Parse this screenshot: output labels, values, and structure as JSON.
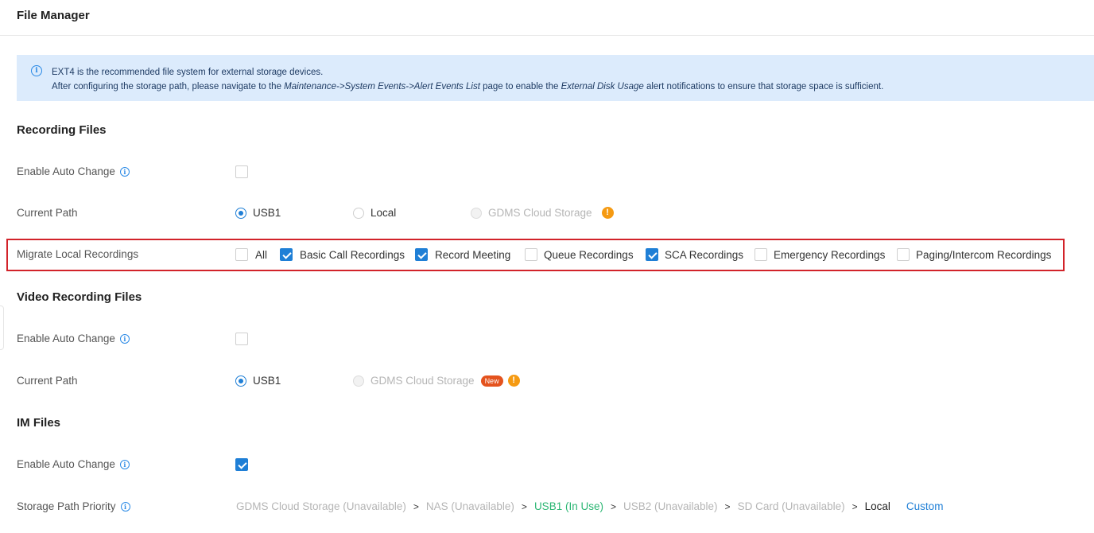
{
  "header": {
    "title": "File Manager"
  },
  "notice": {
    "line1": "EXT4 is the recommended file system for external storage devices.",
    "line2_a": "After configuring the storage path, please navigate to the ",
    "line2_link": "Maintenance->System Events->Alert Events List",
    "line2_b": " page to enable the ",
    "line2_em": "External Disk Usage",
    "line2_c": " alert notifications to ensure that storage space is sufficient."
  },
  "recording": {
    "title": "Recording Files",
    "auto_change_label": "Enable Auto Change",
    "auto_change_checked": false,
    "path_label": "Current Path",
    "path_options": [
      "USB1",
      "Local",
      "GDMS Cloud Storage"
    ],
    "path_selected": "USB1",
    "migrate_label": "Migrate Local Recordings",
    "migrate_options": [
      {
        "label": "All",
        "checked": false
      },
      {
        "label": "Basic Call Recordings",
        "checked": true
      },
      {
        "label": "Record Meeting",
        "checked": true
      },
      {
        "label": "Queue Recordings",
        "checked": false
      },
      {
        "label": "SCA Recordings",
        "checked": true
      },
      {
        "label": "Emergency Recordings",
        "checked": false
      },
      {
        "label": "Paging/Intercom Recordings",
        "checked": false
      }
    ]
  },
  "video": {
    "title": "Video Recording Files",
    "auto_change_label": "Enable Auto Change",
    "auto_change_checked": false,
    "path_label": "Current Path",
    "path_options": [
      "USB1",
      "GDMS Cloud Storage"
    ],
    "path_selected": "USB1",
    "new_badge": "New"
  },
  "im": {
    "title": "IM Files",
    "auto_change_label": "Enable Auto Change",
    "auto_change_checked": true,
    "priority_label": "Storage Path Priority",
    "priority": [
      "GDMS Cloud Storage (Unavailable)",
      "NAS (Unavailable)",
      "USB1 (In Use)",
      "USB2 (Unavailable)",
      "SD Card (Unavailable)",
      "Local"
    ],
    "priority_separator": ">",
    "custom_link": "Custom"
  },
  "colors": {
    "accent": "#1f7fd6",
    "warning": "#f59a12",
    "highlight": "#d2232a",
    "in_use": "#2bb673"
  }
}
